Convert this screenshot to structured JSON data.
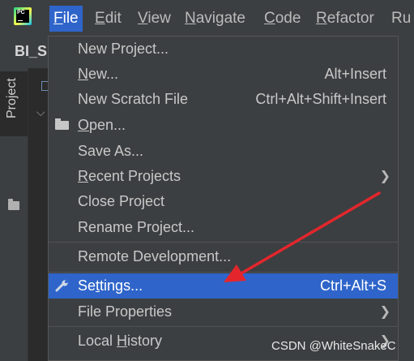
{
  "menubar": {
    "items": [
      {
        "label": "File",
        "mnemonic": "F",
        "rest": "ile"
      },
      {
        "label": "Edit",
        "mnemonic": "E",
        "rest": "dit"
      },
      {
        "label": "View",
        "mnemonic": "V",
        "rest": "iew"
      },
      {
        "label": "Navigate",
        "mnemonic": "N",
        "rest": "avigate"
      },
      {
        "label": "Code",
        "mnemonic": "C",
        "rest": "ode"
      },
      {
        "label": "Refactor",
        "mnemonic": "R",
        "rest": "efactor"
      },
      {
        "label": "Ru"
      }
    ]
  },
  "app": {
    "logo_text": "PC",
    "project_name_fragment": "BI_SI"
  },
  "sidebar": {
    "project_tab": "Project"
  },
  "file_menu": {
    "items": [
      {
        "pre": "New Project...",
        "u": "",
        "post": "",
        "shortcut": ""
      },
      {
        "pre": "",
        "u": "N",
        "post": "ew...",
        "shortcut": "Alt+Insert"
      },
      {
        "pre": "New Scratch File",
        "u": "",
        "post": "",
        "shortcut": "Ctrl+Alt+Shift+Insert"
      },
      {
        "pre": "",
        "u": "O",
        "post": "pen...",
        "shortcut": "",
        "icon": "folder-open-icon"
      },
      {
        "pre": "Save As...",
        "u": "",
        "post": "",
        "shortcut": ""
      },
      {
        "pre": "",
        "u": "R",
        "post": "ecent Projects",
        "submenu": true
      },
      {
        "pre": "Close Project",
        "u": "",
        "post": "",
        "shortcut": ""
      },
      {
        "pre": "Rename Project...",
        "u": "",
        "post": "",
        "shortcut": ""
      },
      {
        "pre": "Remote Development...",
        "u": "",
        "post": "",
        "shortcut": ""
      },
      {
        "pre": "Se",
        "u": "t",
        "post": "tings...",
        "shortcut": "Ctrl+Alt+S",
        "icon": "wrench-icon",
        "selected": true
      },
      {
        "pre": "File Properties",
        "u": "",
        "post": "",
        "submenu": true
      },
      {
        "pre": "Local ",
        "u": "H",
        "post": "istory",
        "submenu": true
      }
    ]
  },
  "watermark": "CSDN @WhiteSnakeC",
  "colors": {
    "selection": "#2f65ca",
    "annotation_arrow": "#e3262c",
    "background": "#3c3f41"
  }
}
